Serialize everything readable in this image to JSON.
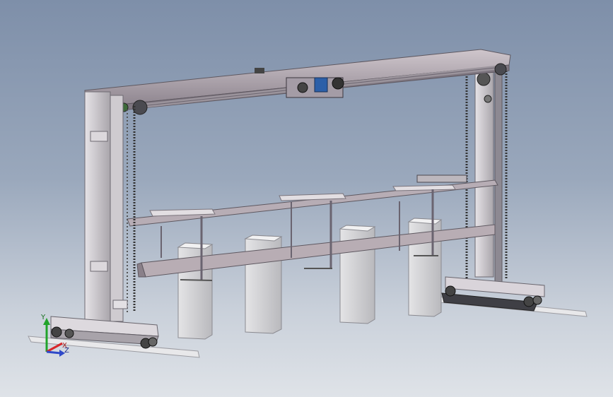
{
  "viewport": {
    "background_top": "#7e8fa9",
    "background_bottom": "#dfe3e8",
    "model_description_icon": "gantry-frame-model"
  },
  "triad": {
    "x_label": "X",
    "y_label": "Y",
    "z_label": "Z",
    "x_color": "#d8262a",
    "y_color": "#21a32b",
    "z_color": "#2f49c9"
  }
}
